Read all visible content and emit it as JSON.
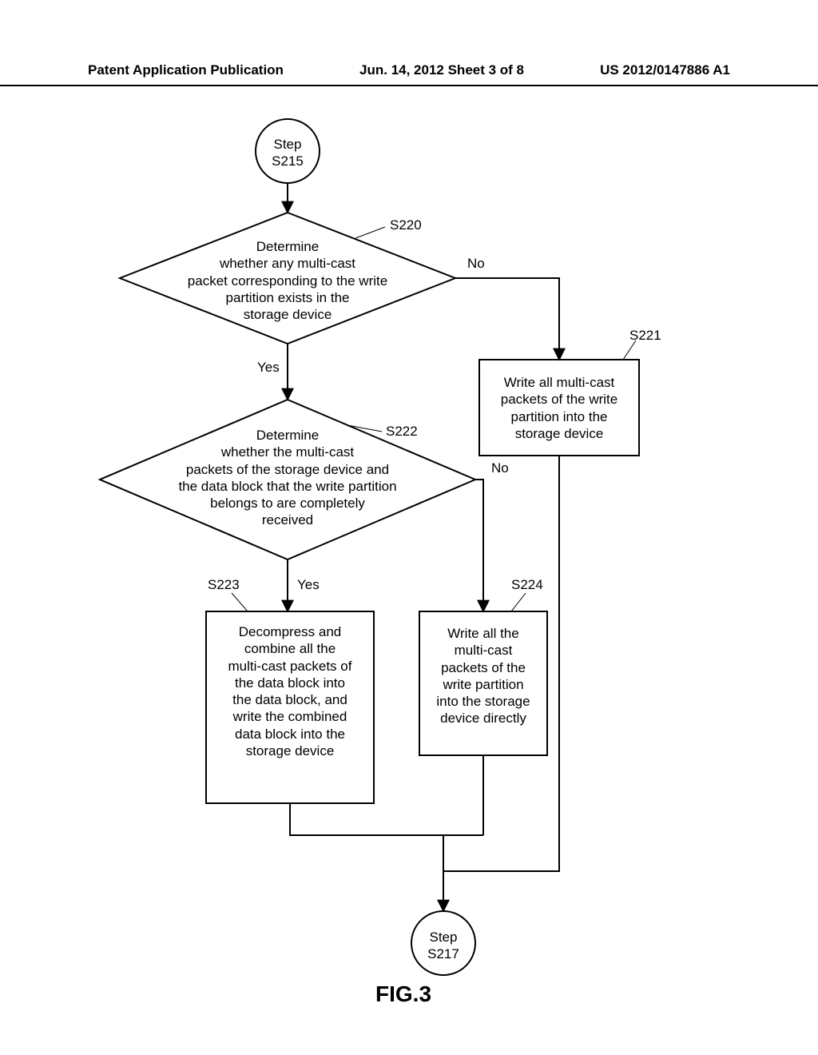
{
  "header": {
    "left": "Patent Application Publication",
    "center": "Jun. 14, 2012  Sheet 3 of 8",
    "right": "US 2012/0147886 A1"
  },
  "figure_label": "FIG.3",
  "nodes": {
    "start": {
      "line1": "Step",
      "line2": "S215"
    },
    "d1": {
      "text": "Determine\nwhether any multi-cast\npacket corresponding to the write\npartition exists in the\nstorage device",
      "ref": "S220"
    },
    "d2": {
      "text": "Determine\nwhether the multi-cast\npackets of the storage device and\nthe data block that the write partition\nbelongs to are completely\nreceived",
      "ref": "S222"
    },
    "p221": {
      "text": "Write all multi-cast\npackets of the write\npartition into the\nstorage device",
      "ref": "S221"
    },
    "p223": {
      "text": "Decompress and\ncombine all the\nmulti-cast packets of\nthe data block into\nthe data block, and\nwrite the combined\ndata block into the\nstorage device",
      "ref": "S223"
    },
    "p224": {
      "text": "Write all the\nmulti-cast\npackets of the\nwrite partition\ninto the storage\ndevice directly",
      "ref": "S224"
    },
    "end": {
      "line1": "Step",
      "line2": "S217"
    }
  },
  "edges": {
    "d1_no": "No",
    "d1_yes": "Yes",
    "d2_no": "No",
    "d2_yes": "Yes"
  },
  "chart_data": {
    "type": "flowchart",
    "title": "FIG.3",
    "nodes": [
      {
        "id": "start",
        "type": "connector",
        "label": "Step S215"
      },
      {
        "id": "S220",
        "type": "decision",
        "label": "Determine whether any multi-cast packet corresponding to the write partition exists in the storage device"
      },
      {
        "id": "S221",
        "type": "process",
        "label": "Write all multi-cast packets of the write partition into the storage device"
      },
      {
        "id": "S222",
        "type": "decision",
        "label": "Determine whether the multi-cast packets of the storage device and the data block that the write partition belongs to are completely received"
      },
      {
        "id": "S223",
        "type": "process",
        "label": "Decompress and combine all the multi-cast packets of the data block into the data block, and write the combined data block into the storage device"
      },
      {
        "id": "S224",
        "type": "process",
        "label": "Write all the multi-cast packets of the write partition into the storage device directly"
      },
      {
        "id": "end",
        "type": "connector",
        "label": "Step S217"
      }
    ],
    "edges": [
      {
        "from": "start",
        "to": "S220"
      },
      {
        "from": "S220",
        "to": "S221",
        "label": "No"
      },
      {
        "from": "S220",
        "to": "S222",
        "label": "Yes"
      },
      {
        "from": "S222",
        "to": "S223",
        "label": "Yes"
      },
      {
        "from": "S222",
        "to": "S224",
        "label": "No"
      },
      {
        "from": "S221",
        "to": "end"
      },
      {
        "from": "S223",
        "to": "end"
      },
      {
        "from": "S224",
        "to": "end"
      }
    ]
  }
}
